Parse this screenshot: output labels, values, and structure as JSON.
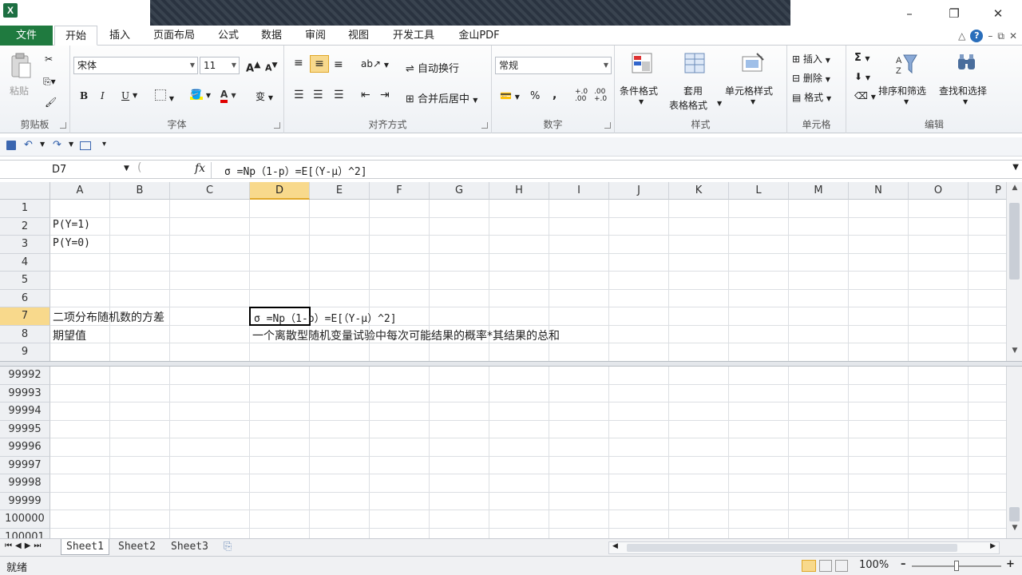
{
  "app": {
    "icon_text": "X"
  },
  "window": {
    "minimize": "–",
    "maximize": "❐",
    "close": "✕"
  },
  "menu": {
    "file": "文件",
    "tabs": [
      "开始",
      "插入",
      "页面布局",
      "公式",
      "数据",
      "审阅",
      "视图",
      "开发工具",
      "金山PDF"
    ],
    "active_tab": "开始",
    "right_icons": {
      "collapse": "△",
      "help": "?",
      "min": "–",
      "restore": "⧉",
      "close": "✕"
    }
  },
  "ribbon": {
    "clipboard": {
      "label": "剪贴板",
      "paste": "粘贴"
    },
    "font": {
      "label": "字体",
      "font_name": "宋体",
      "font_size": "11",
      "grow": "A",
      "shrink": "A",
      "bold": "B",
      "italic": "I",
      "underline": "U",
      "font_color_letter": "A",
      "phonetic": "变"
    },
    "alignment": {
      "label": "对齐方式",
      "wrap": "自动换行",
      "merge": "合并后居中"
    },
    "number": {
      "label": "数字",
      "format": "常规",
      "percent": "%",
      "comma": ",",
      "inc_dec": "+.0\n.00",
      "dec_dec": ".00\n+.0"
    },
    "styles": {
      "label": "样式",
      "conditional": "条件格式",
      "table_line1": "套用",
      "table_line2": "表格格式",
      "cell_styles": "单元格样式"
    },
    "cells": {
      "label": "单元格",
      "insert": "插入",
      "delete": "删除",
      "format": "格式"
    },
    "editing": {
      "label": "编辑",
      "sum": "Σ",
      "sort": "排序和筛选",
      "find": "查找和选择"
    }
  },
  "formula_bar": {
    "name_box": "D7",
    "fx": "fx",
    "formula": "σ =Np（1-p）=E[（Y-μ）^2]"
  },
  "grid": {
    "columns": [
      "A",
      "B",
      "C",
      "D",
      "E",
      "F",
      "G",
      "H",
      "I",
      "J",
      "K",
      "L",
      "M",
      "N",
      "O",
      "P"
    ],
    "selected_column": "D",
    "top_rows": [
      "1",
      "2",
      "3",
      "4",
      "5",
      "6",
      "7",
      "8",
      "9"
    ],
    "selected_row": "7",
    "bottom_rows": [
      "99992",
      "99993",
      "99994",
      "99995",
      "99996",
      "99997",
      "99998",
      "99999",
      "100000",
      "100001"
    ],
    "cells": {
      "a2": "P(Y=1)",
      "a3": "P(Y=0)",
      "a7": "二项分布随机数的方差",
      "d7": "σ =Np（1-p）=E[（Y-μ）^2]",
      "a8": "期望值",
      "d8": "一个离散型随机变量试验中每次可能结果的概率*其结果的总和"
    }
  },
  "sheets": {
    "tabs": [
      "Sheet1",
      "Sheet2",
      "Sheet3"
    ],
    "active": "Sheet1"
  },
  "status": {
    "ready": "就绪",
    "zoom": "100%",
    "minus": "–",
    "plus": "+"
  }
}
